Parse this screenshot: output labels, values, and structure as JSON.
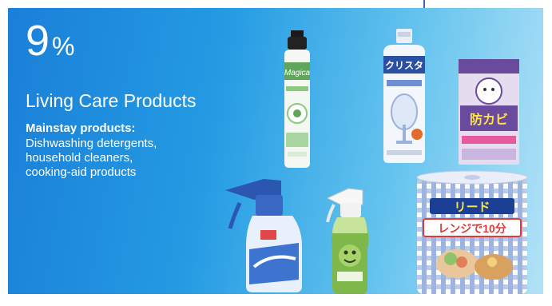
{
  "share": {
    "value": "9",
    "unit": "%"
  },
  "category": "Living Care Products",
  "mainstay": {
    "label": "Mainstay products:",
    "items": [
      "Dishwashing detergents,",
      "household cleaners,",
      "cooking-aid products"
    ]
  },
  "products": [
    {
      "icon": "dishwashing-detergent-bottle-icon",
      "brand": "Magica"
    },
    {
      "icon": "dishwasher-detergent-container-icon",
      "brand": "クリスタ"
    },
    {
      "icon": "mold-prevention-box-icon",
      "brand": "防カビ"
    },
    {
      "icon": "spray-cleaner-bottle-icon",
      "brand": ""
    },
    {
      "icon": "kitchen-spray-bottle-icon",
      "brand": ""
    },
    {
      "icon": "cooking-paper-roll-icon",
      "brand": "リード",
      "tagline": "レンジで10分"
    }
  ],
  "colors": {
    "panel_start": "#1a7fd8",
    "panel_end": "#b3e2f7",
    "text": "#ffffff",
    "accent_line": "#2f6fb7"
  }
}
